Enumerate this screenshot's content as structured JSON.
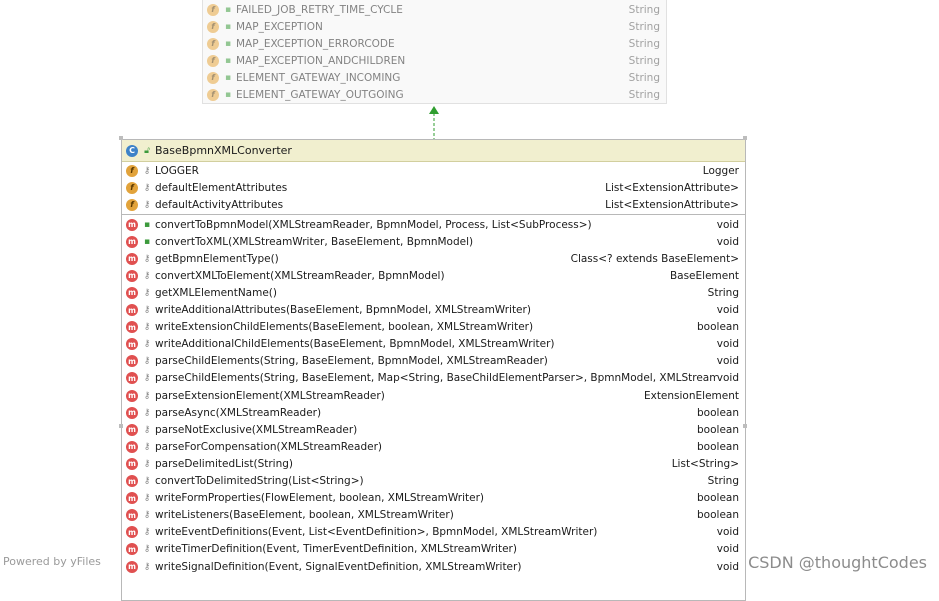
{
  "parent_class": {
    "fields": [
      {
        "name": "FAILED_JOB_RETRY_TIME_CYCLE",
        "type": "String"
      },
      {
        "name": "MAP_EXCEPTION",
        "type": "String"
      },
      {
        "name": "MAP_EXCEPTION_ERRORCODE",
        "type": "String"
      },
      {
        "name": "MAP_EXCEPTION_ANDCHILDREN",
        "type": "String"
      },
      {
        "name": "ELEMENT_GATEWAY_INCOMING",
        "type": "String"
      },
      {
        "name": "ELEMENT_GATEWAY_OUTGOING",
        "type": "String"
      }
    ]
  },
  "class": {
    "name": "BaseBpmnXMLConverter",
    "icon_letter": "C",
    "fields": [
      {
        "name": "LOGGER",
        "type": "Logger"
      },
      {
        "name": "defaultElementAttributes",
        "type": "List<ExtensionAttribute>"
      },
      {
        "name": "defaultActivityAttributes",
        "type": "List<ExtensionAttribute>"
      }
    ],
    "methods": [
      {
        "name": "convertToBpmnModel(XMLStreamReader, BpmnModel, Process, List<SubProcess>)",
        "type": "void",
        "visibility": "public"
      },
      {
        "name": "convertToXML(XMLStreamWriter, BaseElement, BpmnModel)",
        "type": "void",
        "visibility": "public"
      },
      {
        "name": "getBpmnElementType()",
        "type": "Class<? extends BaseElement>",
        "visibility": "protected"
      },
      {
        "name": "convertXMLToElement(XMLStreamReader, BpmnModel)",
        "type": "BaseElement",
        "visibility": "protected"
      },
      {
        "name": "getXMLElementName()",
        "type": "String",
        "visibility": "protected"
      },
      {
        "name": "writeAdditionalAttributes(BaseElement, BpmnModel, XMLStreamWriter)",
        "type": "void",
        "visibility": "protected"
      },
      {
        "name": "writeExtensionChildElements(BaseElement, boolean, XMLStreamWriter)",
        "type": "boolean",
        "visibility": "protected"
      },
      {
        "name": "writeAdditionalChildElements(BaseElement, BpmnModel, XMLStreamWriter)",
        "type": "void",
        "visibility": "protected"
      },
      {
        "name": "parseChildElements(String, BaseElement, BpmnModel, XMLStreamReader)",
        "type": "void",
        "visibility": "protected"
      },
      {
        "name": "parseChildElements(String, BaseElement, Map<String, BaseChildElementParser>, BpmnModel, XMLStreamReader)",
        "type": "void",
        "visibility": "protected"
      },
      {
        "name": "parseExtensionElement(XMLStreamReader)",
        "type": "ExtensionElement",
        "visibility": "protected"
      },
      {
        "name": "parseAsync(XMLStreamReader)",
        "type": "boolean",
        "visibility": "protected"
      },
      {
        "name": "parseNotExclusive(XMLStreamReader)",
        "type": "boolean",
        "visibility": "protected"
      },
      {
        "name": "parseForCompensation(XMLStreamReader)",
        "type": "boolean",
        "visibility": "protected"
      },
      {
        "name": "parseDelimitedList(String)",
        "type": "List<String>",
        "visibility": "protected"
      },
      {
        "name": "convertToDelimitedString(List<String>)",
        "type": "String",
        "visibility": "protected"
      },
      {
        "name": "writeFormProperties(FlowElement, boolean, XMLStreamWriter)",
        "type": "boolean",
        "visibility": "protected"
      },
      {
        "name": "writeListeners(BaseElement, boolean, XMLStreamWriter)",
        "type": "boolean",
        "visibility": "protected"
      },
      {
        "name": "writeEventDefinitions(Event, List<EventDefinition>, BpmnModel, XMLStreamWriter)",
        "type": "void",
        "visibility": "protected"
      },
      {
        "name": "writeTimerDefinition(Event, TimerEventDefinition, XMLStreamWriter)",
        "type": "void",
        "visibility": "protected"
      },
      {
        "name": "writeSignalDefinition(Event, SignalEventDefinition, XMLStreamWriter)",
        "type": "void",
        "visibility": "protected"
      }
    ]
  },
  "footer": {
    "powered_by": "Powered by yFiles",
    "watermark": "CSDN @thoughtCodes"
  },
  "colors": {
    "header_bg": "#f1efcf",
    "field_icon": "#e2a33b",
    "method_icon": "#e05050",
    "class_icon": "#3d82c8",
    "arrow": "#2f9e2f"
  },
  "icons": {
    "field": "field-icon",
    "method": "method-icon",
    "class": "class-icon",
    "public_visibility": "public-lock-icon",
    "protected_visibility": "protected-key-icon",
    "inheritance": "inheritance-arrow-icon"
  }
}
